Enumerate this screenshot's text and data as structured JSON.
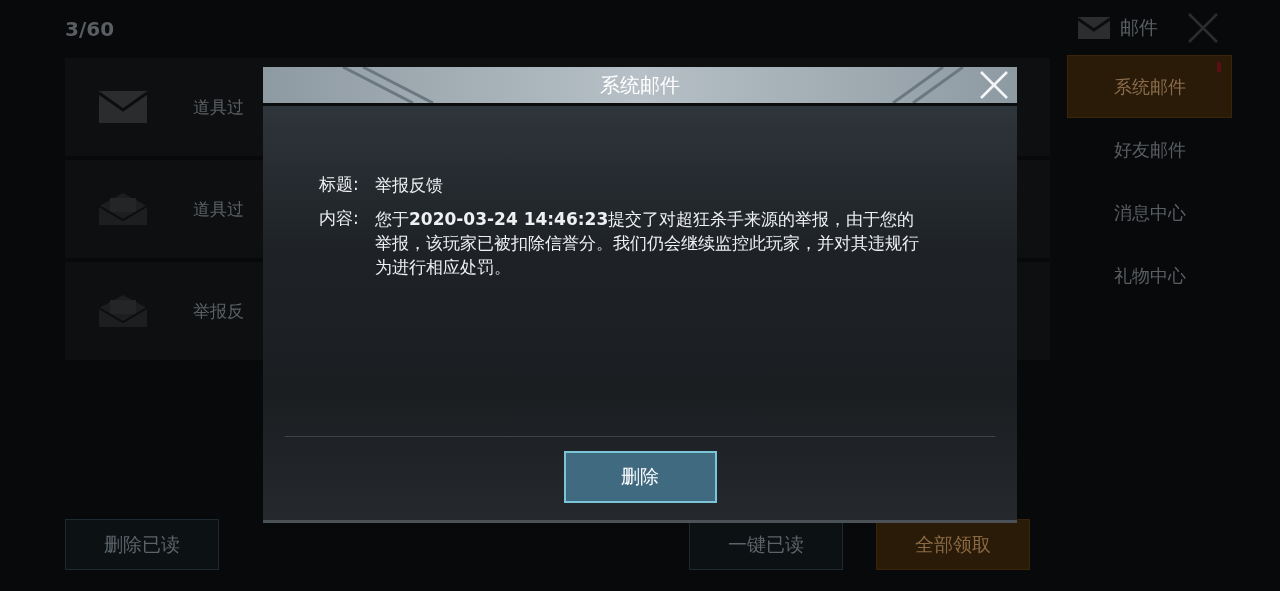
{
  "header": {
    "count": "3/60",
    "title": "邮件"
  },
  "mails": [
    {
      "title": "道具过",
      "read": false
    },
    {
      "title": "道具过",
      "read": true
    },
    {
      "title": "举报反",
      "read": true
    }
  ],
  "tabs": [
    {
      "label": "系统邮件",
      "selected": true,
      "badge": true
    },
    {
      "label": "好友邮件",
      "selected": false,
      "badge": false
    },
    {
      "label": "消息中心",
      "selected": false,
      "badge": false
    },
    {
      "label": "礼物中心",
      "selected": false,
      "badge": false
    }
  ],
  "footer_buttons": [
    {
      "label": "删除已读",
      "kind": "plain"
    },
    {
      "label": "一键已读",
      "kind": "plain"
    },
    {
      "label": "全部领取",
      "kind": "accent"
    }
  ],
  "dialog": {
    "title": "系统邮件",
    "fields": [
      {
        "label": "标题:",
        "value": "举报反馈"
      },
      {
        "label": "内容:",
        "value": "您于**2020-03-24 14:46:23**提交了对超狂杀手来源的举报，由于您的举报，该玩家已被扣除信誉分。我们仍会继续监控此玩家，并对其违规行为进行相应处罚。"
      }
    ],
    "button": "删除"
  }
}
